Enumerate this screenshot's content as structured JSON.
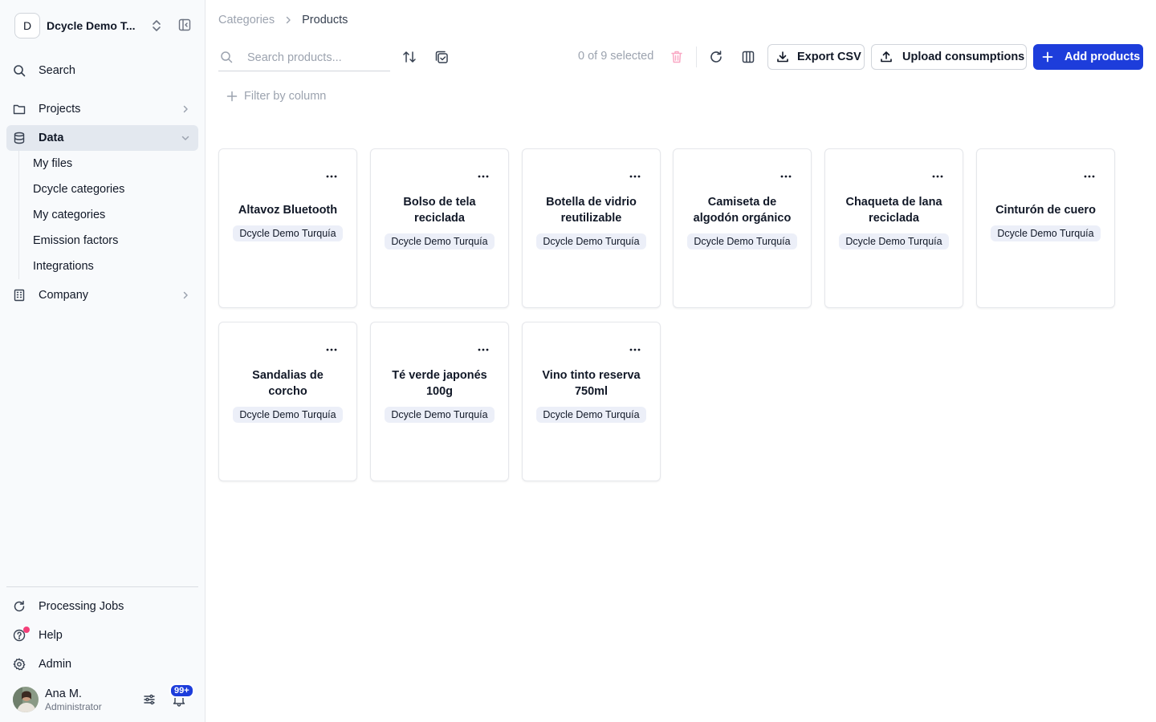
{
  "sidebar": {
    "org": {
      "initial": "D",
      "name": "Dcycle Demo T..."
    },
    "search_label": "Search",
    "items": {
      "projects": "Projects",
      "data": "Data",
      "company": "Company"
    },
    "data_subitems": [
      "My files",
      "Dcycle categories",
      "My categories",
      "Emission factors",
      "Integrations"
    ],
    "bottom": {
      "processing_jobs": "Processing Jobs",
      "help": "Help",
      "admin": "Admin"
    },
    "user": {
      "name": "Ana M.",
      "role": "Administrator",
      "notifications": "99+"
    }
  },
  "breadcrumb": {
    "parent": "Categories",
    "separator": ">",
    "current": "Products"
  },
  "toolbar": {
    "search_placeholder": "Search products...",
    "selection": "0 of 9 selected",
    "export_label": "Export CSV",
    "upload_label": "Upload consumptions",
    "add_label": "Add products"
  },
  "filter_label": "Filter by column",
  "products": [
    {
      "name": "Altavoz Bluetooth",
      "org": "Dcycle Demo Turquía"
    },
    {
      "name": "Bolso de tela reciclada",
      "org": "Dcycle Demo Turquía"
    },
    {
      "name": "Botella de vidrio reutilizable",
      "org": "Dcycle Demo Turquía"
    },
    {
      "name": "Camiseta de algodón orgánico",
      "org": "Dcycle Demo Turquía"
    },
    {
      "name": "Chaqueta de lana reciclada",
      "org": "Dcycle Demo Turquía"
    },
    {
      "name": "Cinturón de cuero",
      "org": "Dcycle Demo Turquía"
    },
    {
      "name": "Sandalias de corcho",
      "org": "Dcycle Demo Turquía"
    },
    {
      "name": "Té verde japonés 100g",
      "org": "Dcycle Demo Turquía"
    },
    {
      "name": "Vino tinto reserva 750ml",
      "org": "Dcycle Demo Turquía"
    }
  ],
  "colors": {
    "primary": "#1d3ddb",
    "delete_icon": "#f9a8c4",
    "notification_dot": "#f43f79",
    "sidebar_bg": "#f8fafc",
    "active_nav_bg": "#e3e8ef"
  }
}
